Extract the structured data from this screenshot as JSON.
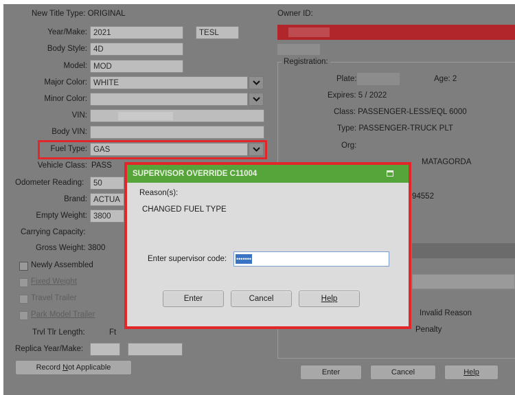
{
  "form": {
    "new_title_type": "New Title Type: ORIGINAL",
    "owner_id_label": "Owner ID:",
    "year_make_label": "Year/Make:",
    "year_value": "2021",
    "make_value": "TESL",
    "body_style_label": "Body Style:",
    "body_style_value": "4D",
    "model_label": "Model:",
    "model_value": "MOD",
    "major_color_label": "Major Color:",
    "major_color_value": "WHITE",
    "minor_color_label": "Minor Color:",
    "minor_color_value": "",
    "vin_label": "VIN:",
    "body_vin_label": "Body VIN:",
    "fuel_type_label": "Fuel Type:",
    "fuel_type_value": "GAS",
    "vehicle_class_label": "Vehicle Class:",
    "vehicle_class_value": "PASS",
    "odometer_label": "Odometer Reading:",
    "odometer_value": "50",
    "brand_label": "Brand:",
    "brand_value": "ACTUA",
    "empty_weight_label": "Empty Weight:",
    "empty_weight_value": "3800",
    "carrying_capacity_label": "Carrying Capacity:",
    "gross_weight_text": "Gross Weight: 3800",
    "newly_assembled_label": "Newly Assembled",
    "fixed_weight_label": "Fixed Weight",
    "travel_trailer_label": "Travel Trailer",
    "park_model_trailer_label": "Park Model Trailer",
    "trvl_tlr_length_label": "Trvl Tlr Length:",
    "ft_label": "Ft",
    "replica_label": "Replica Year/Make:",
    "record_na_prefix": "Record ",
    "record_na_underlined": "N",
    "record_na_suffix": "ot Applicable"
  },
  "registration": {
    "title": "Registration:",
    "plate_label": "Plate:",
    "age_text": "Age: 2",
    "expires_text": "Expires: 5    / 2022",
    "class_text": "Class: PASSENGER-LESS/EQL 6000",
    "type_text": "Type: PASSENGER-TRUCK PLT",
    "org_label": "Org:",
    "county_text": "MATAGORDA",
    "number_fragment": "94552",
    "invalid_reason": "Invalid Reason",
    "penalty": "Penalty"
  },
  "bottom_buttons": {
    "enter": "Enter",
    "cancel": "Cancel",
    "help": "Help"
  },
  "dialog": {
    "title": "SUPERVISOR OVERRIDE C11004",
    "reasons_label": "Reason(s):",
    "reason_text": "CHANGED FUEL TYPE",
    "code_label": "Enter supervisor code:",
    "code_value": "•••••••",
    "enter_button": "Enter",
    "cancel_button": "Cancel",
    "help_button": "Help"
  },
  "colors": {
    "highlight_red": "#e2262a",
    "dialog_title_green": "#55a53a",
    "owner_banner_red": "#b0262b"
  }
}
